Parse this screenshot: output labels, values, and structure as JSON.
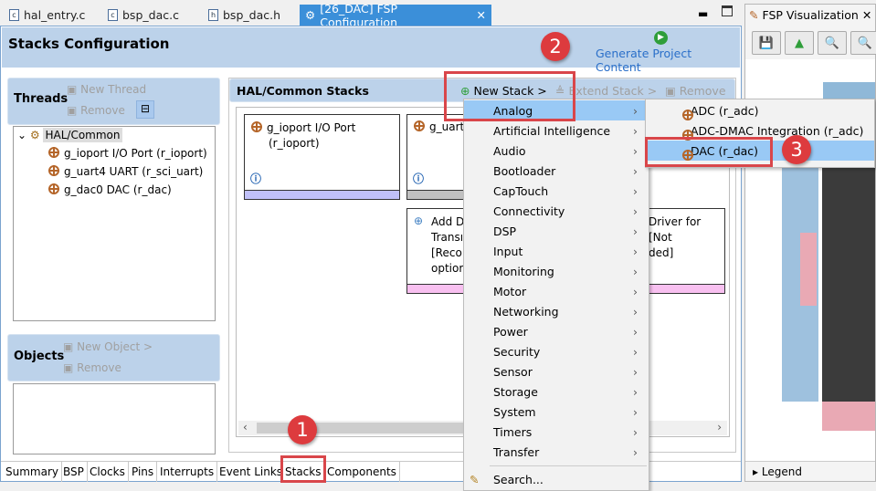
{
  "editor_tabs": [
    {
      "label": "hal_entry.c",
      "icon": "c-file-icon"
    },
    {
      "label": "bsp_dac.c",
      "icon": "c-file-icon"
    },
    {
      "label": "bsp_dac.h",
      "icon": "h-file-icon"
    },
    {
      "label": "[26_DAC] FSP Configuration",
      "icon": "gear-icon",
      "active": true
    }
  ],
  "header": {
    "title": "Stacks Configuration",
    "generate_label": "Generate Project Content"
  },
  "threads": {
    "title": "Threads",
    "new_thread": "New Thread",
    "remove": "Remove",
    "tree": {
      "root": "HAL/Common",
      "items": [
        "g_ioport I/O Port (r_ioport)",
        "g_uart4 UART (r_sci_uart)",
        "g_dac0 DAC (r_dac)"
      ]
    }
  },
  "objects": {
    "title": "Objects",
    "new_object": "New Object >",
    "remove": "Remove"
  },
  "stacks": {
    "title": "HAL/Common Stacks",
    "new_stack": "New Stack >",
    "extend_stack": "Extend Stack >",
    "remove": "Remove",
    "cards": [
      {
        "line1": "g_ioport I/O Port",
        "line2": "(r_ioport)",
        "color": "#c0c0f8"
      },
      {
        "line1": "g_uart",
        "color": "#c0c0c0"
      },
      {
        "lines": [
          "Add D",
          "Transı",
          "[Reco",
          "optior"
        ],
        "right": [
          "Driver for",
          "[Not",
          "ded]"
        ],
        "color": "#f8c0f0"
      }
    ]
  },
  "menu": {
    "items": [
      "Analog",
      "Artificial Intelligence",
      "Audio",
      "Bootloader",
      "CapTouch",
      "Connectivity",
      "DSP",
      "Input",
      "Monitoring",
      "Motor",
      "Networking",
      "Power",
      "Security",
      "Sensor",
      "Storage",
      "System",
      "Timers",
      "Transfer"
    ],
    "search": "Search...",
    "selected": "Analog"
  },
  "submenu": {
    "items": [
      "ADC (r_adc)",
      "ADC-DMAC Integration (r_adc)",
      "DAC (r_dac)"
    ],
    "selected": "DAC (r_dac)"
  },
  "bottom_tabs": [
    "Summary",
    "BSP",
    "Clocks",
    "Pins",
    "Interrupts",
    "Event Links",
    "Stacks",
    "Components"
  ],
  "active_bottom_tab": "Stacks",
  "visualization": {
    "title": "FSP Visualization",
    "legend": "Legend"
  },
  "annotations": [
    "1",
    "2",
    "3"
  ],
  "colors": {
    "accent": "#3b8fd9",
    "header": "#bcd2ea",
    "annotation": "#dd3b3e",
    "selection": "#99c9f5"
  }
}
